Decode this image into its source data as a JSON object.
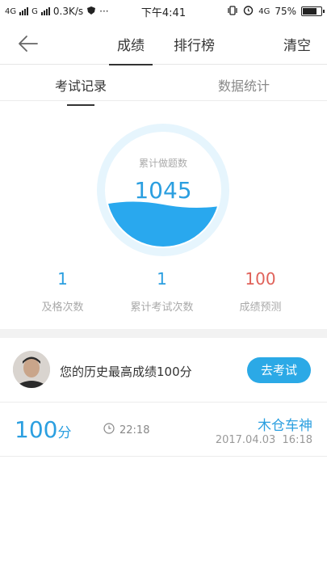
{
  "status_bar": {
    "signal_left": "4G",
    "signal_mid": "G",
    "speed": "0.3K/s",
    "more": "···",
    "time": "下午4:41",
    "network": "4G",
    "battery_percent": "75%",
    "battery_level": 0.75
  },
  "nav": {
    "tabs": [
      {
        "label": "成绩",
        "active": true
      },
      {
        "label": "排行榜",
        "active": false
      }
    ],
    "clear_label": "清空"
  },
  "subtabs": [
    {
      "label": "考试记录",
      "active": true
    },
    {
      "label": "数据统计",
      "active": false
    }
  ],
  "gauge": {
    "label": "累计做题数",
    "value": "1045",
    "color": "#29a8ee",
    "ring_color": "#e6f5fd"
  },
  "stats": [
    {
      "value": "1",
      "label": "及格次数",
      "color": "blue"
    },
    {
      "value": "1",
      "label": "累计考试次数",
      "color": "blue"
    },
    {
      "value": "100",
      "label": "成绩预测",
      "color": "red"
    }
  ],
  "best": {
    "text": "您的历史最高成绩100分",
    "button_label": "去考试"
  },
  "records": [
    {
      "score": "100",
      "unit": "分",
      "duration": "22:18",
      "name": "木仓车神",
      "date": "2017.04.03  16:18"
    }
  ],
  "colors": {
    "accent": "#2b9fe0",
    "button": "#2ba9e6",
    "red": "#e0625a"
  }
}
